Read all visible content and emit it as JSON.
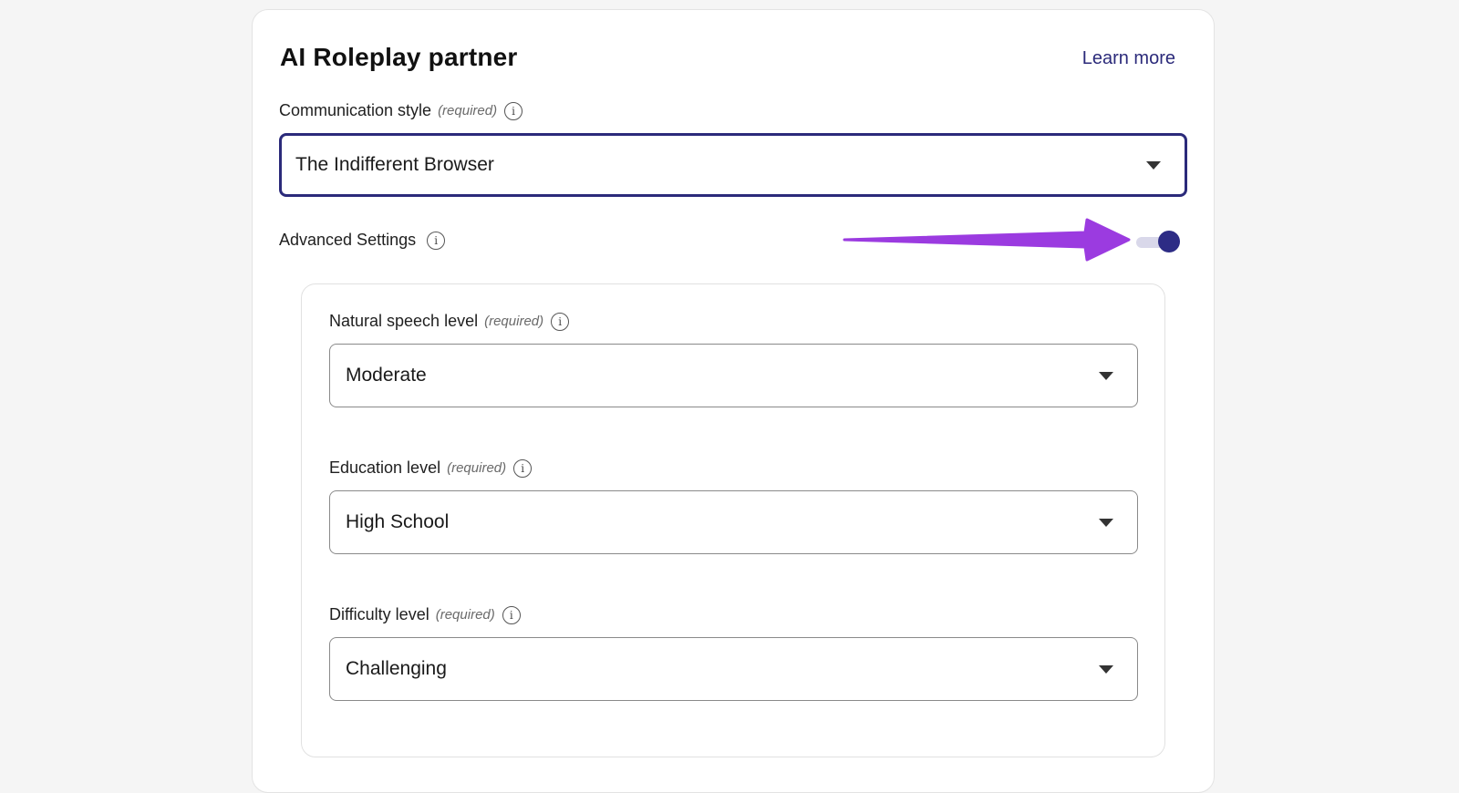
{
  "card": {
    "title": "AI Roleplay partner",
    "learn_more": "Learn more"
  },
  "communication_style": {
    "label": "Communication style",
    "required": "(required)",
    "value": "The Indifferent Browser"
  },
  "advanced_settings": {
    "label": "Advanced Settings",
    "enabled": true
  },
  "natural_speech": {
    "label": "Natural speech level",
    "required": "(required)",
    "value": "Moderate"
  },
  "education": {
    "label": "Education level",
    "required": "(required)",
    "value": "High School"
  },
  "difficulty": {
    "label": "Difficulty level",
    "required": "(required)",
    "value": "Challenging"
  },
  "icons": {
    "info": "info-icon",
    "dropdown": "chevron-down-icon",
    "annotation": "arrow-annotation"
  },
  "colors": {
    "accent": "#2b2a7a",
    "toggle_knob": "#2d2c85",
    "toggle_track": "#d9d8ea",
    "annotation_arrow": "#9b3be0"
  }
}
